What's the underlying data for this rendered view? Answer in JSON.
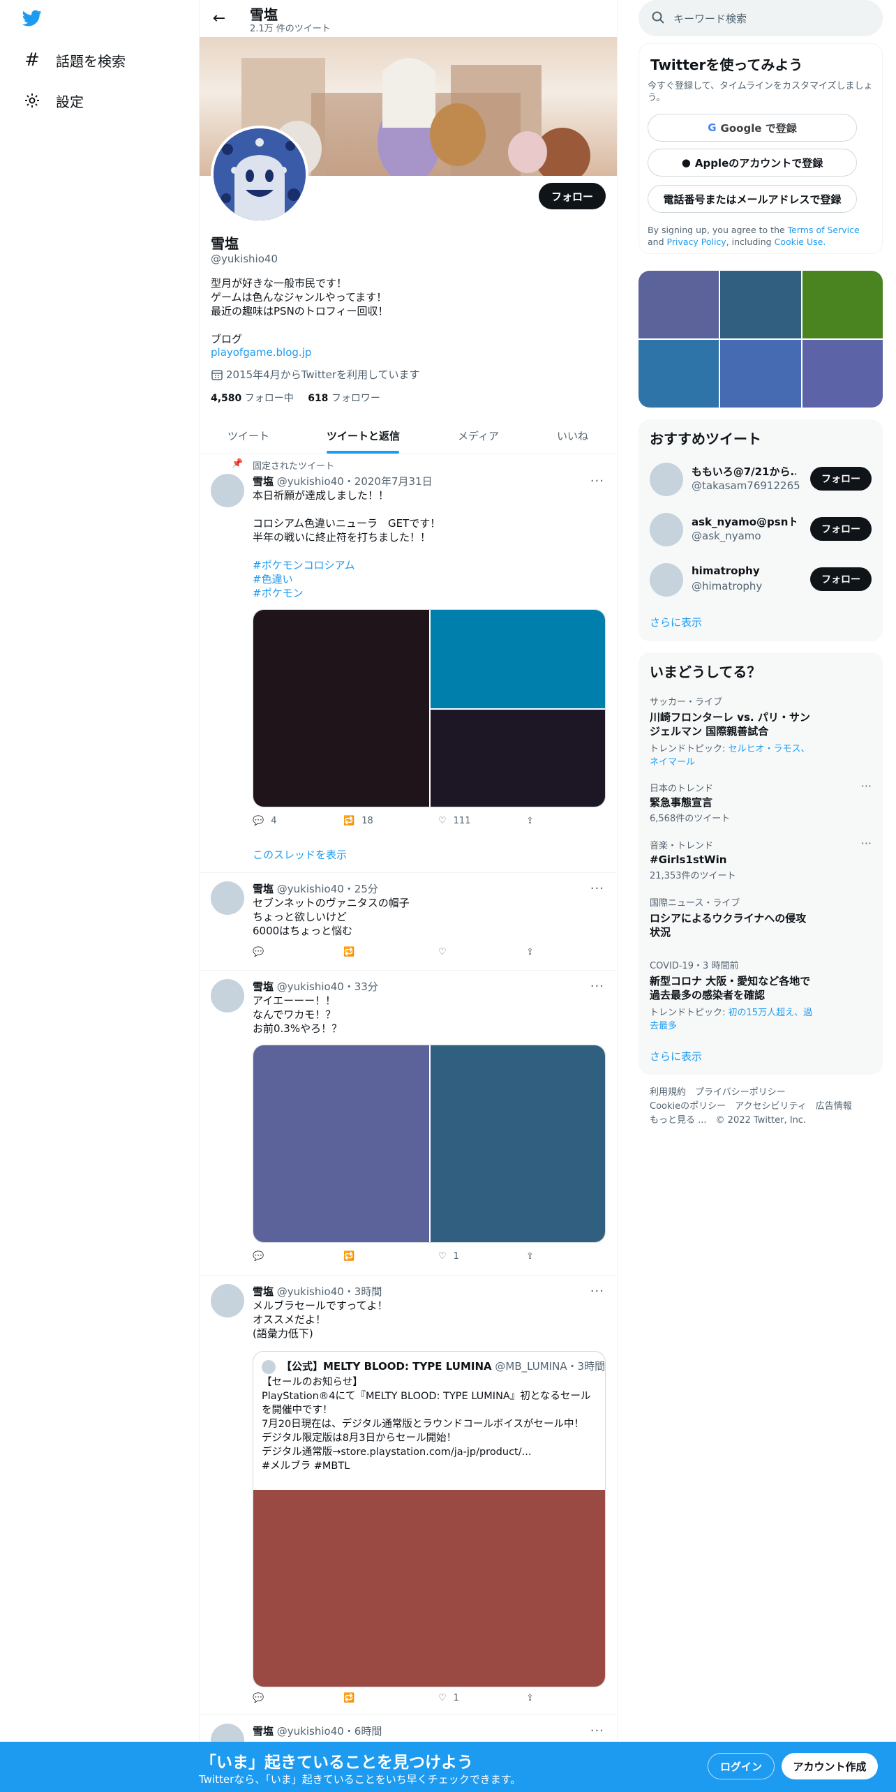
{
  "nav": {
    "explore": "話題を検索",
    "settings": "設定"
  },
  "header": {
    "name": "雪塩",
    "tweet_count": "2.1万 件のツイート"
  },
  "profile": {
    "follow": "フォロー",
    "name": "雪塩",
    "handle": "@yukishio40",
    "bio": [
      "型月が好きな一般市民です！",
      "ゲームは色んなジャンルやってます！",
      "最近の趣味はPSNのトロフィー回収！",
      "",
      "ブログ"
    ],
    "blog": "playofgame.blog.jp",
    "joined": "2015年4月からTwitterを利用しています",
    "following_count": "4,580",
    "following_label": "フォロー中",
    "followers_count": "618",
    "followers_label": "フォロワー"
  },
  "tabs": [
    "ツイート",
    "ツイートと返信",
    "メディア",
    "いいね"
  ],
  "tweets": [
    {
      "pinned": "固定されたツイート",
      "name": "雪塩",
      "handle": "@yukishio40",
      "time": "・2020年7月31日",
      "lines": [
        "本日祈願が達成しました！！",
        "",
        "コロシアム色違いニューラ　GETです！",
        "半年の戦いに終止符を打ちました！！",
        ""
      ],
      "tags": [
        "#ポケモンコロシアム",
        "#色違い",
        "#ポケモン"
      ],
      "replies": "4",
      "retweets": "18",
      "likes": "111",
      "thread": "このスレッドを表示"
    },
    {
      "name": "雪塩",
      "handle": "@yukishio40",
      "time": "・25分",
      "lines": [
        "セブンネットのヴァニタスの帽子",
        "ちょっと欲しいけど",
        "6000はちょっと悩む"
      ]
    },
    {
      "name": "雪塩",
      "handle": "@yukishio40",
      "time": "・33分",
      "lines": [
        "アイエーーー！！",
        "なんでワカモ！？",
        "お前0.3%やろ！？"
      ],
      "likes": "1"
    },
    {
      "name": "雪塩",
      "handle": "@yukishio40",
      "time": "・3時間",
      "lines": [
        "メルブラセールですってよ！",
        "オススメだよ！",
        "(語彙力低下)"
      ],
      "likes": "1",
      "quote": {
        "name": "【公式】MELTY BLOOD: TYPE LUMINA",
        "handle": "@MB_LUMINA",
        "time": "・3時間",
        "lines": [
          "【セールのお知らせ】",
          "PlayStation®4にて『MELTY BLOOD: TYPE LUMINA』初となるセール",
          "を開催中です！",
          "7月20日現在は、デジタル通常版とラウンドコールボイスがセール中！",
          "デジタル限定版は8月3日からセール開始！",
          "デジタル通常版→store.playstation.com/ja-jp/product/...",
          "#メルブラ #MBTL"
        ]
      }
    },
    {
      "name": "雪塩",
      "handle": "@yukishio40",
      "time": "・6時間"
    }
  ],
  "right": {
    "search_placeholder": "キーワード検索",
    "signup": {
      "title": "Twitterを使ってみよう",
      "sub": "今すぐ登録して、タイムラインをカスタマイズしましょう。",
      "google": "Google で登録",
      "apple": "Appleのアカウントで登録",
      "phone": "電話番号またはメールアドレスで登録",
      "terms_pre": "By signing up, you agree to the",
      "terms": "Terms of Service",
      "and": "and",
      "privacy": "Privacy Policy",
      "including": ", including",
      "cookie": "Cookie Use."
    },
    "recommend": {
      "title": "おすすめツイート",
      "users": [
        {
          "name": "ももいろ@7/21から...",
          "handle": "@takasam76912265"
        },
        {
          "name": "ask_nyamo@psnト...",
          "handle": "@ask_nyamo"
        },
        {
          "name": "himatrophy",
          "handle": "@himatrophy"
        }
      ],
      "follow": "フォロー",
      "more": "さらに表示"
    },
    "trends": {
      "title": "いまどうしてる？",
      "items": [
        {
          "cat": "サッカー・ライブ",
          "title1": "川崎フロンターレ vs. パリ・サン",
          "title2": "ジェルマン 国際親善試合",
          "topic_pre": "トレンドトピック:",
          "topic1": "セルヒオ・ラモス、",
          "topic2": "ネイマール"
        },
        {
          "cat": "日本のトレンド",
          "title1": "緊急事態宣言",
          "count": "6,568件のツイート"
        },
        {
          "cat": "音楽・トレンド",
          "title1": "#Girls1stWin",
          "count": "21,353件のツイート"
        },
        {
          "cat": "国際ニュース・ライブ",
          "title1": "ロシアによるウクライナへの侵攻",
          "title2": "状況"
        },
        {
          "cat": "COVID-19・3 時間前",
          "title1": "新型コロナ 大阪・愛知など各地で",
          "title2": "過去最多の感染者を確認",
          "topic_pre": "トレンドトピック:",
          "topic1": "初の15万人超え、過",
          "topic2": "去最多"
        }
      ],
      "more": "さらに表示"
    },
    "footer": [
      "利用規約",
      "プライバシーポリシー",
      "Cookieのポリシー",
      "アクセシビリティ",
      "広告情報",
      "もっと見る ...",
      "© 2022 Twitter, Inc."
    ]
  },
  "bottom": {
    "title": "「いま」起きていることを見つけよう",
    "sub": "Twitterなら、「いま」起きていることをいち早くチェックできます。",
    "login": "ログイン",
    "signup": "アカウント作成"
  }
}
